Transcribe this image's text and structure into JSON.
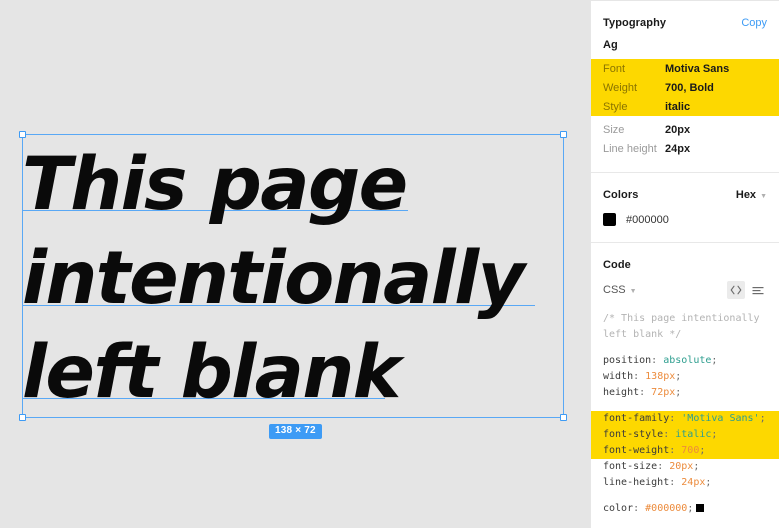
{
  "canvas": {
    "background_color": "#e5e5e5",
    "selection_color": "#3d9bf5",
    "text_layer": "This page\nintentionally\nleft blank",
    "size_badge": "138 × 72"
  },
  "panel": {
    "typography": {
      "title": "Typography",
      "copy_label": "Copy",
      "preview": "Ag",
      "rows": [
        {
          "key": "Font",
          "value": "Motiva Sans",
          "highlighted": true
        },
        {
          "key": "Weight",
          "value": "700, Bold",
          "highlighted": true
        },
        {
          "key": "Style",
          "value": "italic",
          "highlighted": true
        },
        {
          "key": "Size",
          "value": "20px",
          "highlighted": false
        },
        {
          "key": "Line height",
          "value": "24px",
          "highlighted": false
        }
      ],
      "highlight_color": "#fdd800"
    },
    "colors": {
      "title": "Colors",
      "format": "Hex",
      "swatches": [
        {
          "hex": "#000000",
          "label": "#000000"
        }
      ]
    },
    "code": {
      "title": "Code",
      "language": "CSS",
      "view_code_icon": "code-brackets-icon",
      "view_list_icon": "text-lines-icon",
      "comment": "/* This page intentionally left blank */",
      "declarations": [
        {
          "prop": "position",
          "value": "absolute",
          "value_kind": "keyword",
          "highlighted": false
        },
        {
          "prop": "width",
          "value": "138px",
          "value_kind": "number",
          "highlighted": false
        },
        {
          "prop": "height",
          "value": "72px",
          "value_kind": "number",
          "highlighted": false
        },
        {
          "prop": "font-family",
          "value": "'Motiva Sans'",
          "value_kind": "string",
          "highlighted": true
        },
        {
          "prop": "font-style",
          "value": "italic",
          "value_kind": "keyword",
          "highlighted": true
        },
        {
          "prop": "font-weight",
          "value": "700",
          "value_kind": "number",
          "highlighted": true
        },
        {
          "prop": "font-size",
          "value": "20px",
          "value_kind": "number",
          "highlighted": false
        },
        {
          "prop": "line-height",
          "value": "24px",
          "value_kind": "number",
          "highlighted": false
        },
        {
          "prop": "color",
          "value": "#000000",
          "value_kind": "number",
          "highlighted": false,
          "swatch": "#000000"
        }
      ]
    }
  }
}
